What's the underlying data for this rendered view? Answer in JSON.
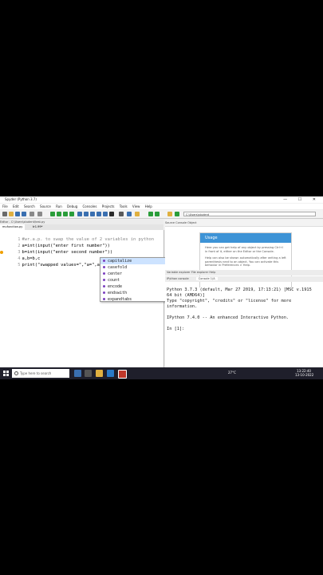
{
  "window": {
    "title": "Spyder (Python 3.7)",
    "controls": "— ☐ ✕"
  },
  "menubar": [
    "File",
    "Edit",
    "Search",
    "Source",
    "Run",
    "Debug",
    "Consoles",
    "Projects",
    "Tools",
    "View",
    "Help"
  ],
  "toolbar": {
    "path": "C:\\Users\\student"
  },
  "editor": {
    "header": "Editor - C:\\Users\\student\\test.py",
    "tabs": [
      "mufunction.py",
      "tr1.99*"
    ],
    "lines": [
      {
        "num": "1",
        "code": "#wr.a.p. to swap the value of 2 variables in python"
      },
      {
        "num": "2",
        "code": "a=int(input(\"enter first number\"))"
      },
      {
        "num": "3",
        "code": "b=int(input(\"enter second number\"))"
      },
      {
        "num": "4",
        "code": "a,b=b,c"
      },
      {
        "num": "5",
        "code": "print(\"swapped values=\",\"a=\",a,\"b=\".)"
      }
    ]
  },
  "autocomplete": {
    "items": [
      "capitalize",
      "casefold",
      "center",
      "count",
      "encode",
      "endswith",
      "expandtabs"
    ],
    "selected": "capitalize"
  },
  "help": {
    "header": "Source  Console  Object",
    "usage_title": "Usage",
    "usage_text1": "Here you can get help of any object by pressing Ctrl+I in front of it, either on the Editor or the Console.",
    "usage_text2": "Help can also be shown automatically after writing a left parenthesis next to an object. You can activate this behavior in Preferences > Help.",
    "tabs": "Variable explorer   File explorer   Help"
  },
  "console": {
    "header": "IPython console",
    "tab": "Console 1/A",
    "lines": [
      "Python 3.7.3 (default, Mar 27 2019, 17:13:21) [MSC v.1915",
      "64 bit (AMD64)]",
      "Type \"copyright\", \"credits\" or \"license\" for more",
      "information.",
      "",
      "IPython 7.4.0 -- An enhanced Interactive Python.",
      "",
      "In [1]:"
    ]
  },
  "taskbar": {
    "search_placeholder": "Type here to search",
    "temperature": "27°C",
    "time": "13:22:40",
    "date": "13-10-2022"
  },
  "colors": {
    "usage_header": "#3d93d6",
    "selection": "#cde3ff",
    "taskbar": "#1f1f2b"
  }
}
